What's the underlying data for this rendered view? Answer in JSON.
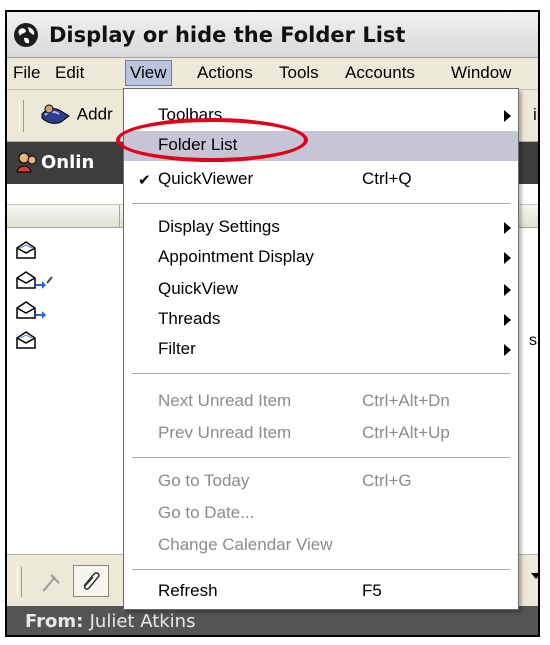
{
  "window": {
    "title": "Display or hide the Folder List"
  },
  "menubar": {
    "items": [
      "File",
      "Edit",
      "View",
      "Actions",
      "Tools",
      "Accounts",
      "Window"
    ],
    "active_index": 2
  },
  "toolbar": {
    "address_label": "Addr",
    "right_fragment": "il"
  },
  "panel_header": {
    "title": "Onlin"
  },
  "list": {
    "right_fragment": "s>"
  },
  "preview": {
    "from_label": "From:",
    "from_value": "Juliet Atkins"
  },
  "view_menu": {
    "items": [
      {
        "label": "Toolbars",
        "shortcut": "",
        "submenu": true,
        "disabled": false
      },
      {
        "label": "Folder List",
        "shortcut": "",
        "submenu": false,
        "disabled": false,
        "highlighted": true
      },
      {
        "label": "QuickViewer",
        "shortcut": "Ctrl+Q",
        "submenu": false,
        "disabled": false,
        "checked": true
      },
      {
        "label": "Display Settings",
        "shortcut": "",
        "submenu": true,
        "disabled": false
      },
      {
        "label": "Appointment Display",
        "shortcut": "",
        "submenu": true,
        "disabled": false
      },
      {
        "label": "QuickView",
        "shortcut": "",
        "submenu": true,
        "disabled": false
      },
      {
        "label": "Threads",
        "shortcut": "",
        "submenu": true,
        "disabled": false
      },
      {
        "label": "Filter",
        "shortcut": "",
        "submenu": true,
        "disabled": false
      },
      {
        "label": "Next Unread Item",
        "shortcut": "Ctrl+Alt+Dn",
        "submenu": false,
        "disabled": true
      },
      {
        "label": "Prev Unread Item",
        "shortcut": "Ctrl+Alt+Up",
        "submenu": false,
        "disabled": true
      },
      {
        "label": "Go to Today",
        "shortcut": "Ctrl+G",
        "submenu": false,
        "disabled": true
      },
      {
        "label": "Go to Date...",
        "shortcut": "",
        "submenu": false,
        "disabled": true
      },
      {
        "label": "Change Calendar View",
        "shortcut": "",
        "submenu": false,
        "disabled": true
      },
      {
        "label": "Refresh",
        "shortcut": "F5",
        "submenu": false,
        "disabled": false
      }
    ]
  },
  "colors": {
    "annotation_ring": "#e0001a",
    "menu_highlight": "#c6c5d6",
    "disabled_text": "#8b8b8b"
  }
}
